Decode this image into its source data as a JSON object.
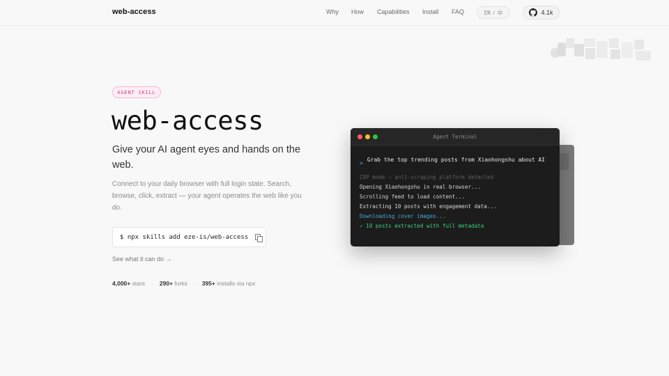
{
  "nav": {
    "brand": "web-access",
    "links": [
      "Why",
      "How",
      "Capabilities",
      "Install",
      "FAQ"
    ],
    "lang": {
      "en": "EN",
      "sep": "/",
      "zh": "中"
    },
    "github": {
      "icon": "github-icon",
      "stars": "4.1k"
    }
  },
  "hero": {
    "badge": "AGENT SKILL",
    "title": "web-access",
    "subtitle": "Give your AI agent eyes and hands on the web.",
    "description": "Connect to your daily browser with full login state. Search, browse, click, extract — your agent operates the web like you do.",
    "command": "$ npx skills add eze-is/web-access",
    "see_link": "See what it can do →",
    "stats": [
      {
        "value": "4,000+",
        "label": "stars"
      },
      {
        "value": "290+",
        "label": "forks"
      },
      {
        "value": "395+",
        "label": "installs via npx"
      }
    ]
  },
  "terminal": {
    "title": "Agent Terminal",
    "prompt_mark": ">",
    "prompt": "Grab the top trending posts from Xiaohongshu about AI",
    "lines": [
      {
        "text": "CDP mode — anti-scraping platform detected",
        "color": "#5f5f5f"
      },
      {
        "text": "Opening Xiaohongshu in real browser...",
        "color": "#d6d6d6"
      },
      {
        "text": "Scrolling feed to load content...",
        "color": "#d6d6d6"
      },
      {
        "text": "Extracting 10 posts with engagement data...",
        "color": "#d6d6d6"
      },
      {
        "text": "Downloading cover images...",
        "color": "#46a8d6"
      },
      {
        "text": "✓ 10 posts extracted with full metadata",
        "color": "#3fd07a"
      }
    ]
  },
  "colors": {
    "accent_pink": "#d23f87",
    "dot_red": "#ff5f57",
    "dot_yellow": "#febc2e",
    "dot_green": "#28c840"
  }
}
